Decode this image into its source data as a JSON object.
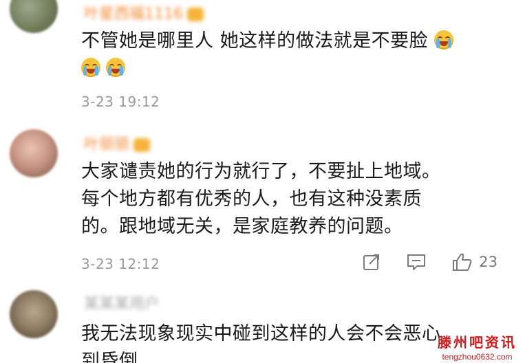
{
  "comments": [
    {
      "username": "叶星西福1116",
      "text_line1": "不管她是哪里人 她这样的做法就是不要脸",
      "time": "3-23 19:12"
    },
    {
      "username": "叶丽丽",
      "text_lines": [
        "大家谴责她的行为就行了，不要扯上地域。",
        "每个地方都有优秀的人，也有这种没素质",
        "的。跟地域无关，是家庭教养的问题。"
      ],
      "time": "3-23 12:12",
      "like_count": "23"
    },
    {
      "username": "某某某用户",
      "text_lines": [
        "我无法现象现实中碰到这样的人会不会恶心",
        "到昏倒"
      ]
    }
  ],
  "watermark": {
    "title": "滕州吧资讯",
    "url": "tengzhou0632.com"
  },
  "icons": {
    "emoji": "crying-emoji-icon",
    "share": "share-icon",
    "reply": "comment-icon",
    "like": "thumbs-up-icon"
  },
  "colors": {
    "username": "#f08a32",
    "meta": "#9a9a9a",
    "watermark": "#d11a1a"
  }
}
